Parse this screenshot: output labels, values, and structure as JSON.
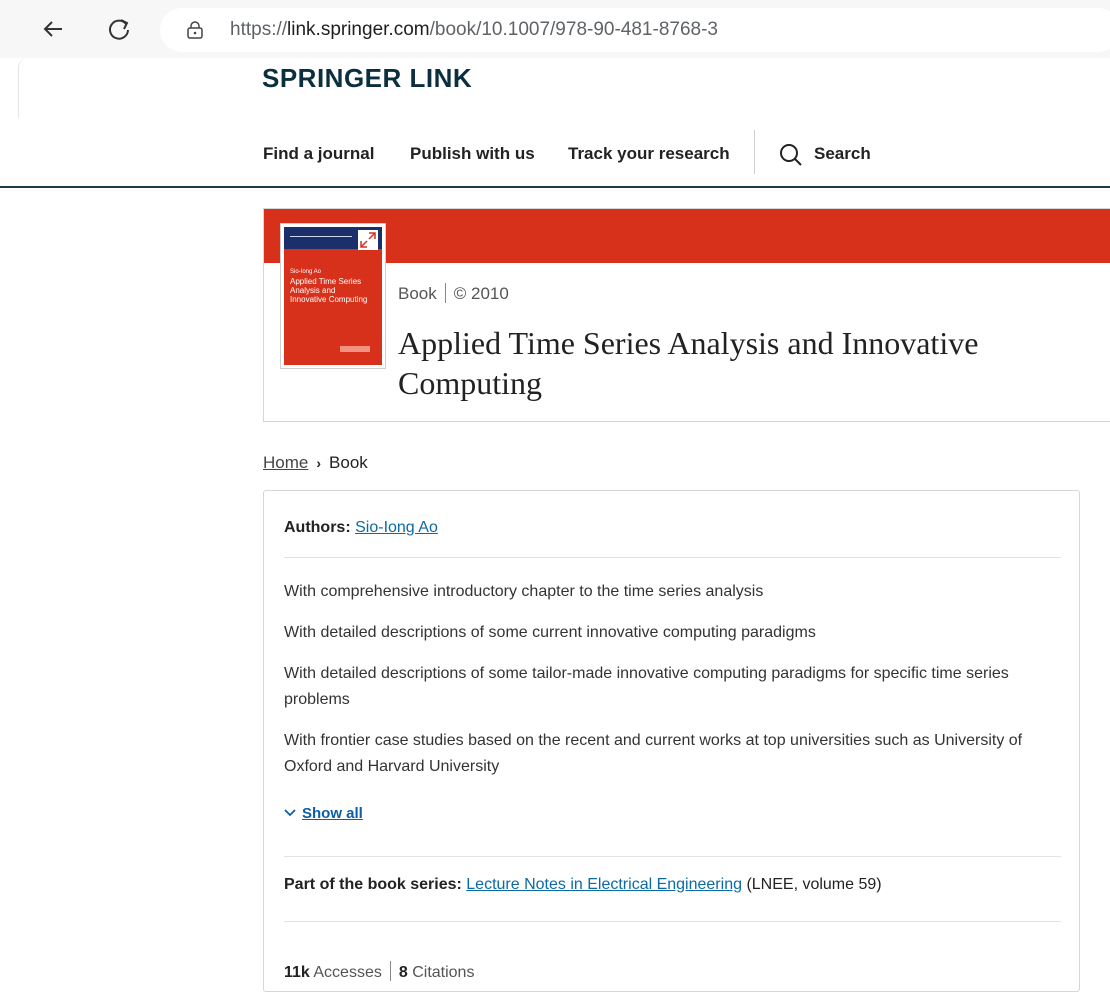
{
  "browser": {
    "url_prefix": "https://",
    "url_host": "link.springer.com",
    "url_path": "/book/10.1007/978-90-481-8768-3"
  },
  "site": {
    "logo": "SPRINGER LINK"
  },
  "nav": {
    "items": [
      "Find a journal",
      "Publish with us",
      "Track your research"
    ],
    "search_label": "Search"
  },
  "book": {
    "type": "Book",
    "copyright": "© 2010",
    "title": "Applied Time Series Analysis and Innovative Computing",
    "cover_author": "Sio-Iong Ao",
    "cover_title": "Applied Time Series Analysis and Innovative Computing"
  },
  "breadcrumb": {
    "home": "Home",
    "current": "Book"
  },
  "details": {
    "authors_label": "Authors:",
    "author": "Sio-Iong Ao",
    "features": [
      "With comprehensive introductory chapter to the time series analysis",
      "With detailed descriptions of some current innovative computing paradigms",
      "With detailed descriptions of some tailor-made innovative computing paradigms for specific time series problems",
      "With frontier case studies based on the recent and current works at top universities such as University of Oxford and Harvard University"
    ],
    "show_all": "Show all",
    "series_label": "Part of the book series:",
    "series_name": "Lecture Notes in Electrical Engineering",
    "series_suffix": "(LNEE, volume 59)",
    "accesses_value": "11k",
    "accesses_label": "Accesses",
    "citations_value": "8",
    "citations_label": "Citations"
  },
  "colors": {
    "brand_red": "#d8311b",
    "link_blue": "#0c6aa7",
    "header_navy": "#0b2f3f"
  }
}
